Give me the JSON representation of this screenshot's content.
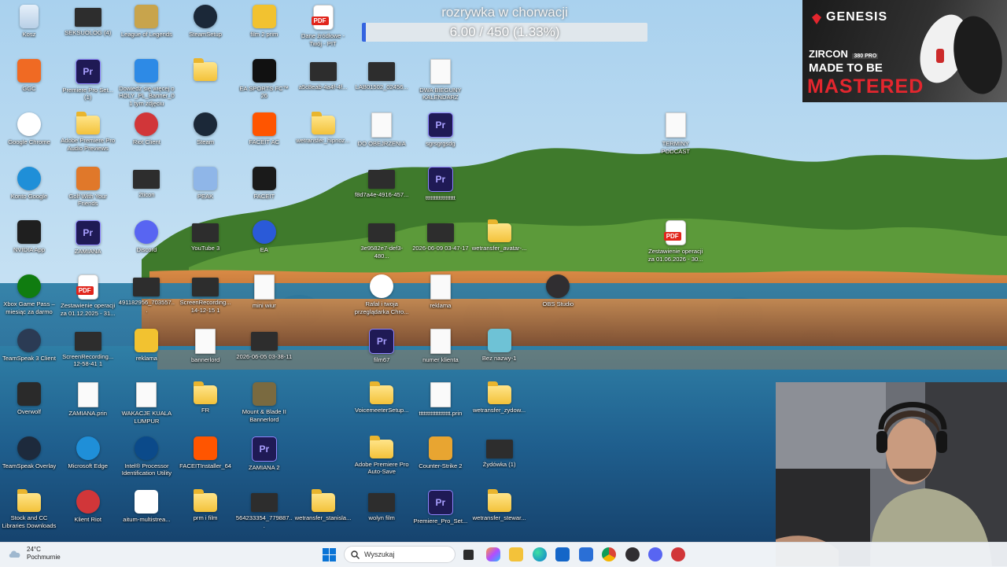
{
  "progress_overlay": {
    "title": "rozrywka w chorwacji",
    "text": "6.00 / 450 (1.33%)",
    "fraction": 0.0133,
    "color": "#3464e0"
  },
  "ad": {
    "brand": "GENESIS",
    "product": "ZIRCON",
    "product_badge": "380 PRO",
    "tagline_1": "MADE TO BE",
    "tagline_2": "MASTERED"
  },
  "taskbar": {
    "weather_temp": "24°C",
    "weather_desc": "Pochmurnie",
    "search_placeholder": "Wyszukaj",
    "pinned": [
      "task-view",
      "copilot",
      "file-explorer",
      "edge",
      "outlook",
      "store",
      "chrome",
      "obs",
      "discord",
      "riot-client"
    ]
  },
  "icons": [
    {
      "label": "Kosz",
      "kind": "bin",
      "icon": "recycle-bin-icon",
      "col": 0,
      "row": 0
    },
    {
      "label": "SEKSUOLOG (4)",
      "kind": "thumb",
      "icon": "video-thumbnail-icon",
      "col": 1,
      "row": 0
    },
    {
      "label": "League of Legends",
      "kind": "app",
      "icon": "league-icon",
      "color": "#c8a44c",
      "col": 2,
      "row": 0
    },
    {
      "label": "SteamSetup",
      "kind": "app",
      "icon": "steam-icon",
      "color": "#1b2838",
      "col": 3,
      "row": 0
    },
    {
      "label": "film 2 prim",
      "kind": "app",
      "icon": "clapperboard-icon",
      "color": "#f2c230",
      "col": 4,
      "row": 0
    },
    {
      "label": "Dane źródłowe - Twój - PIT",
      "kind": "pdf",
      "icon": "pdf-icon",
      "col": 5,
      "row": 0
    },
    {
      "label": "GGC",
      "kind": "app",
      "icon": "ggc-icon",
      "color": "#f06a23",
      "col": 0,
      "row": 1
    },
    {
      "label": "Premiere Pro Set... (1)",
      "kind": "pr",
      "icon": "premiere-pro-icon",
      "col": 1,
      "row": 1
    },
    {
      "label": "Dowiedz się więcej o HOLY_PL_Banner_01 tym zdjęciu",
      "kind": "app",
      "icon": "info-icon",
      "color": "#2d8ae6",
      "col": 2,
      "row": 1
    },
    {
      "label": "",
      "kind": "folder",
      "icon": "folder-icon",
      "col": 3,
      "row": 1
    },
    {
      "label": "EA SPORTS FC™ 26",
      "kind": "app",
      "icon": "ea-fc-icon",
      "color": "#111111",
      "col": 4,
      "row": 1
    },
    {
      "label": "a5c8eab-4a4f-4f...",
      "kind": "thumb",
      "icon": "image-thumbnail-icon",
      "col": 5,
      "row": 1
    },
    {
      "label": "LAB01502_02456...",
      "kind": "thumb",
      "icon": "video-thumbnail-icon",
      "col": 6,
      "row": 1
    },
    {
      "label": "DWA BIEGUNY KALENDARZ",
      "kind": "file",
      "icon": "document-icon",
      "col": 7,
      "row": 1
    },
    {
      "label": "Google Chrome",
      "kind": "app",
      "icon": "chrome-icon",
      "color": "#ffffff",
      "col": 0,
      "row": 2
    },
    {
      "label": "Adobe Premiere Pro Audio Previews",
      "kind": "folder",
      "icon": "folder-icon",
      "col": 1,
      "row": 2
    },
    {
      "label": "Riot Client",
      "kind": "app",
      "icon": "riot-client-icon",
      "color": "#d13639",
      "col": 2,
      "row": 2
    },
    {
      "label": "Steam",
      "kind": "app",
      "icon": "steam-icon",
      "color": "#1b2838",
      "col": 3,
      "row": 2
    },
    {
      "label": "FACEIT AC",
      "kind": "app",
      "icon": "faceit-ac-icon",
      "color": "#ff5500",
      "col": 4,
      "row": 2
    },
    {
      "label": "wetransfer_hipnoz...",
      "kind": "folder",
      "icon": "folder-icon",
      "col": 5,
      "row": 2
    },
    {
      "label": "DO OBEJRZENIA",
      "kind": "file",
      "icon": "document-icon",
      "col": 6,
      "row": 2
    },
    {
      "label": "sgrsgrgsdg",
      "kind": "pr",
      "icon": "premiere-project-icon",
      "col": 7,
      "row": 2
    },
    {
      "label": "TERMINY PODCAST",
      "kind": "file",
      "icon": "document-icon",
      "col": 11,
      "row": 2
    },
    {
      "label": "Konto Google",
      "kind": "app",
      "icon": "edge-icon",
      "color": "#1f8fd8",
      "col": 0,
      "row": 3
    },
    {
      "label": "Golf With Your Friends",
      "kind": "app",
      "icon": "golf-icon",
      "color": "#e0782a",
      "col": 1,
      "row": 3
    },
    {
      "label": "2ticon",
      "kind": "thumb",
      "icon": "image-thumbnail-icon",
      "col": 2,
      "row": 3
    },
    {
      "label": "PEAK",
      "kind": "app",
      "icon": "peak-icon",
      "color": "#8fb6e8",
      "col": 3,
      "row": 3
    },
    {
      "label": "FACEIT",
      "kind": "app",
      "icon": "faceit-icon",
      "color": "#1a1a1a",
      "col": 4,
      "row": 3
    },
    {
      "label": "f8d7a4e-4916-457...",
      "kind": "thumb",
      "icon": "photo-thumbnail-icon",
      "col": 6,
      "row": 3
    },
    {
      "label": "tttttttttttttttttt",
      "kind": "pr",
      "icon": "premiere-project-icon",
      "col": 7,
      "row": 3
    },
    {
      "label": "NVIDIA App",
      "kind": "app",
      "icon": "nvidia-icon",
      "color": "#1f1f1f",
      "col": 0,
      "row": 4
    },
    {
      "label": "ZAMIANA",
      "kind": "pr",
      "icon": "premiere-project-icon",
      "col": 1,
      "row": 4
    },
    {
      "label": "Discord",
      "kind": "app",
      "icon": "discord-icon",
      "color": "#5865f2",
      "col": 2,
      "row": 4
    },
    {
      "label": "YouTube 3",
      "kind": "thumb",
      "icon": "image-thumbnail-icon",
      "col": 3,
      "row": 4
    },
    {
      "label": "EA",
      "kind": "app",
      "icon": "ea-icon",
      "color": "#2a5ad8",
      "col": 4,
      "row": 4
    },
    {
      "label": "3e9582e7-def3-480...",
      "kind": "thumb",
      "icon": "photo-thumbnail-icon",
      "col": 6,
      "row": 4
    },
    {
      "label": "2026-06-09 03-47-17",
      "kind": "thumb",
      "icon": "video-thumbnail-icon",
      "col": 7,
      "row": 4
    },
    {
      "label": "wetransfer_avatar-...",
      "kind": "folder",
      "icon": "folder-icon",
      "col": 8,
      "row": 4
    },
    {
      "label": "Zestawienie operacji za 01.06.2026 - 30...",
      "kind": "pdf",
      "icon": "pdf-icon",
      "col": 11,
      "row": 4
    },
    {
      "label": "Xbox Game Pass – miesiąc za darmo",
      "kind": "app",
      "icon": "xbox-icon",
      "color": "#107c10",
      "col": 0,
      "row": 5
    },
    {
      "label": "Zestawienie operacji za 01.12.2025 - 31...",
      "kind": "pdf",
      "icon": "pdf-icon",
      "col": 1,
      "row": 5
    },
    {
      "label": "491182956_703557...",
      "kind": "thumb",
      "icon": "photo-thumbnail-icon",
      "col": 2,
      "row": 5
    },
    {
      "label": "ScreenRecording... 14-12-15 1",
      "kind": "thumb",
      "icon": "video-thumbnail-icon",
      "col": 3,
      "row": 5
    },
    {
      "label": "mini wiur",
      "kind": "file",
      "icon": "document-icon",
      "col": 4,
      "row": 5
    },
    {
      "label": "Rafał i twoja przeglądarka Chro...",
      "kind": "app",
      "icon": "chrome-profile-icon",
      "color": "#ffffff",
      "col": 6,
      "row": 5
    },
    {
      "label": "reklama",
      "kind": "file",
      "icon": "document-icon",
      "col": 7,
      "row": 5
    },
    {
      "label": "OBS Studio",
      "kind": "app",
      "icon": "obs-icon",
      "color": "#302e31",
      "col": 9,
      "row": 5
    },
    {
      "label": "TeamSpeak 3 Client",
      "kind": "app",
      "icon": "teamspeak-icon",
      "color": "#2b3b54",
      "col": 0,
      "row": 6
    },
    {
      "label": "ScreenRecording... 12-58-41 1",
      "kind": "thumb",
      "icon": "video-thumbnail-icon",
      "col": 1,
      "row": 6
    },
    {
      "label": "reklama",
      "kind": "app",
      "icon": "clapperboard-icon",
      "color": "#f2c230",
      "col": 2,
      "row": 6
    },
    {
      "label": "bannerlord",
      "kind": "file",
      "icon": "document-icon",
      "col": 3,
      "row": 6
    },
    {
      "label": "2026-06-05 03-38-11",
      "kind": "thumb",
      "icon": "video-thumbnail-icon",
      "col": 4,
      "row": 6
    },
    {
      "label": "film67",
      "kind": "pr",
      "icon": "premiere-project-icon",
      "col": 6,
      "row": 6
    },
    {
      "label": "numer klienta",
      "kind": "file",
      "icon": "document-icon",
      "col": 7,
      "row": 6
    },
    {
      "label": "Bez nazwy-1",
      "kind": "app",
      "icon": "draw-icon",
      "color": "#6ec2d6",
      "col": 8,
      "row": 6
    },
    {
      "label": "Overwolf",
      "kind": "app",
      "icon": "overwolf-icon",
      "color": "#2a2a2a",
      "col": 0,
      "row": 7
    },
    {
      "label": "ZAMIANA.prin",
      "kind": "file",
      "icon": "print-file-icon",
      "col": 1,
      "row": 7
    },
    {
      "label": "WAKACJE KUALA LUMPUR",
      "kind": "file",
      "icon": "document-icon",
      "col": 2,
      "row": 7
    },
    {
      "label": "FR",
      "kind": "folder",
      "icon": "folder-icon",
      "col": 3,
      "row": 7
    },
    {
      "label": "Mount & Blade II Bannerlord",
      "kind": "app",
      "icon": "bannerlord-icon",
      "color": "#7a6a40",
      "col": 4,
      "row": 7
    },
    {
      "label": "VoicemeeterSetup...",
      "kind": "folder",
      "icon": "folder-icon",
      "col": 6,
      "row": 7
    },
    {
      "label": "ttttttttttttttttttt.prin",
      "kind": "file",
      "icon": "print-file-icon",
      "col": 7,
      "row": 7
    },
    {
      "label": "wetransfer_zydow...",
      "kind": "folder",
      "icon": "folder-icon",
      "col": 8,
      "row": 7
    },
    {
      "label": "TeamSpeak Overlay",
      "kind": "app",
      "icon": "teamspeak-overlay-icon",
      "color": "#1d2a3c",
      "col": 0,
      "row": 8
    },
    {
      "label": "Microsoft Edge",
      "kind": "app",
      "icon": "edge-icon",
      "color": "#1f8fd8",
      "col": 1,
      "row": 8
    },
    {
      "label": "Intel® Processor Identification Utility",
      "kind": "app",
      "icon": "intel-icon",
      "color": "#0b4a8a",
      "col": 2,
      "row": 8
    },
    {
      "label": "FACEITInstaller_64",
      "kind": "app",
      "icon": "faceit-ac-icon",
      "color": "#ff5500",
      "col": 3,
      "row": 8
    },
    {
      "label": "ZAMIANA 2",
      "kind": "pr",
      "icon": "premiere-project-icon",
      "col": 4,
      "row": 8
    },
    {
      "label": "Adobe Premiere Pro Auto-Save",
      "kind": "folder",
      "icon": "folder-icon",
      "col": 6,
      "row": 8
    },
    {
      "label": "Counter-Strike 2",
      "kind": "app",
      "icon": "cs2-icon",
      "color": "#e8a531",
      "col": 7,
      "row": 8
    },
    {
      "label": "Żydówka (1)",
      "kind": "thumb",
      "icon": "photo-thumbnail-icon",
      "col": 8,
      "row": 8
    },
    {
      "label": "Stock and CC Libraries Downloads",
      "kind": "folder",
      "icon": "folder-icon",
      "col": 0,
      "row": 9
    },
    {
      "label": "Klient Riot",
      "kind": "app",
      "icon": "riot-client-icon",
      "color": "#d13639",
      "col": 1,
      "row": 9
    },
    {
      "label": "aitum-multistrea...",
      "kind": "app",
      "icon": "aitum-icon",
      "color": "#ffffff",
      "col": 2,
      "row": 9
    },
    {
      "label": "prm i film",
      "kind": "folder",
      "icon": "folder-icon",
      "col": 3,
      "row": 9
    },
    {
      "label": "564233354_779887...",
      "kind": "thumb",
      "icon": "photo-thumbnail-icon",
      "col": 4,
      "row": 9
    },
    {
      "label": "wetransfer_stanisla...",
      "kind": "folder",
      "icon": "folder-icon",
      "col": 5,
      "row": 9
    },
    {
      "label": "wolyn film",
      "kind": "thumb",
      "icon": "photo-thumbnail-icon",
      "col": 6,
      "row": 9
    },
    {
      "label": "Premiere_Pro_Set...",
      "kind": "pr",
      "icon": "premiere-pro-icon",
      "col": 7,
      "row": 9
    },
    {
      "label": "wetransfer_stewar...",
      "kind": "folder",
      "icon": "folder-icon",
      "col": 8,
      "row": 9
    }
  ]
}
